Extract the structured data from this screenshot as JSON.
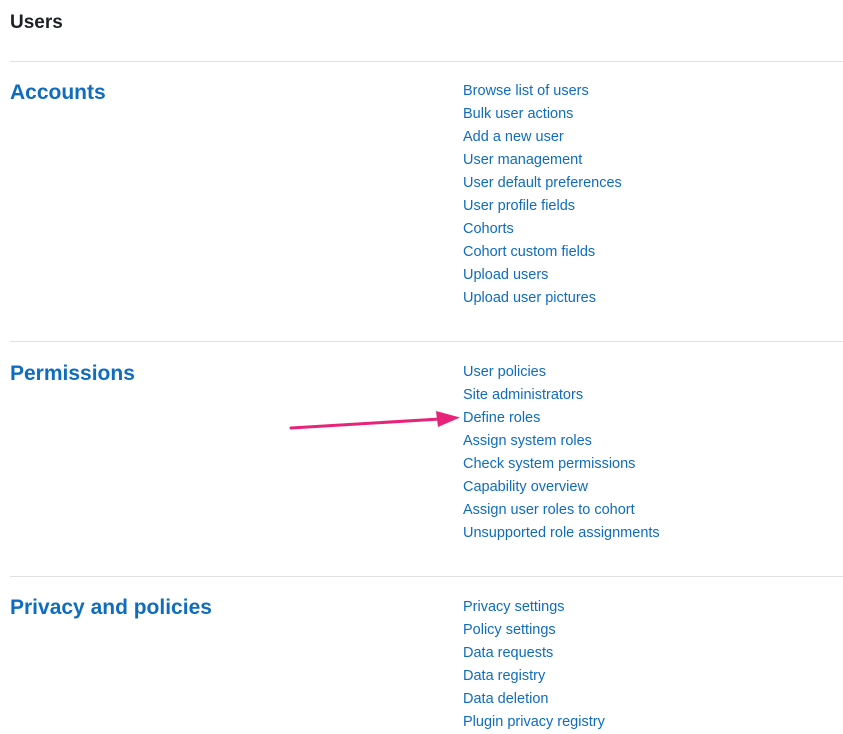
{
  "page": {
    "title": "Users"
  },
  "sections": {
    "accounts": {
      "title": "Accounts",
      "links": [
        "Browse list of users",
        "Bulk user actions",
        "Add a new user",
        "User management",
        "User default preferences",
        "User profile fields",
        "Cohorts",
        "Cohort custom fields",
        "Upload users",
        "Upload user pictures"
      ]
    },
    "permissions": {
      "title": "Permissions",
      "links": [
        "User policies",
        "Site administrators",
        "Define roles",
        "Assign system roles",
        "Check system permissions",
        "Capability overview",
        "Assign user roles to cohort",
        "Unsupported role assignments"
      ]
    },
    "privacy": {
      "title": "Privacy and policies",
      "links": [
        "Privacy settings",
        "Policy settings",
        "Data requests",
        "Data registry",
        "Data deletion",
        "Plugin privacy registry"
      ]
    }
  },
  "annotation": {
    "arrow_color": "#e8237a",
    "arrow_icon": "arrow-right-icon",
    "points_to": "Define roles"
  },
  "colors": {
    "link": "#0f6cbf",
    "heading": "#1d2125",
    "divider": "#dee2e6"
  }
}
